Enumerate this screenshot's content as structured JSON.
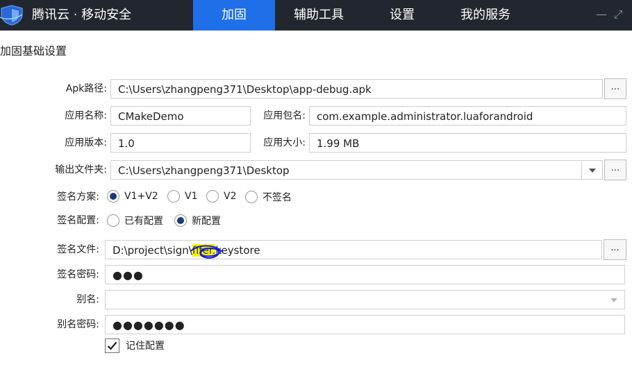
{
  "app": {
    "title": "腾讯云 · 移动安全"
  },
  "nav": {
    "tabs": [
      {
        "label": "加固",
        "active": true
      },
      {
        "label": "辅助工具",
        "active": false
      },
      {
        "label": "设置",
        "active": false
      },
      {
        "label": "我的服务",
        "active": false
      }
    ]
  },
  "window_controls": {
    "minimize": "—",
    "maximize": "⤢"
  },
  "section": {
    "title": "加固基础设置"
  },
  "apk": {
    "label": "Apk路径:",
    "path": "C:\\Users\\zhangpeng371\\Desktop\\app-debug.apk",
    "browse": "..."
  },
  "app_info": {
    "name_label": "应用名称:",
    "name": "CMakeDemo",
    "package_label": "应用包名:",
    "package": "com.example.administrator.luaforandroid",
    "version_label": "应用版本:",
    "version": "1.0",
    "size_label": "应用大小:",
    "size": "1.99 MB"
  },
  "output": {
    "label": "输出文件夹:",
    "path": "C:\\Users\\zhangpeng371\\Desktop",
    "browse": "..."
  },
  "sign_scheme": {
    "label": "签名方案:",
    "options": [
      "V1+V2",
      "V1",
      "V2",
      "不签名"
    ],
    "selected": "V1+V2"
  },
  "sign_config": {
    "label": "签名配置:",
    "options": [
      "已有配置",
      "新配置"
    ],
    "selected": "新配置"
  },
  "keystore": {
    "label": "签名文件:",
    "path_prefix": "D:\\project\\sign\\",
    "path_hidden": "fifer.",
    "path_suffix": "keystore",
    "browse": "..."
  },
  "keystore_password": {
    "label": "签名密码:",
    "value": "●●●"
  },
  "alias": {
    "label": "别名:",
    "value": ""
  },
  "alias_password": {
    "label": "别名密码:",
    "value": "●●●●●●●"
  },
  "remember": {
    "label": "记住配置",
    "checked": true
  },
  "colors": {
    "titlebar": "#22272f",
    "active_tab": "#1e6fe8",
    "radio_selected": "#1a3a7a",
    "highlight": "#f5f500",
    "scribble": "#1a1adf"
  }
}
